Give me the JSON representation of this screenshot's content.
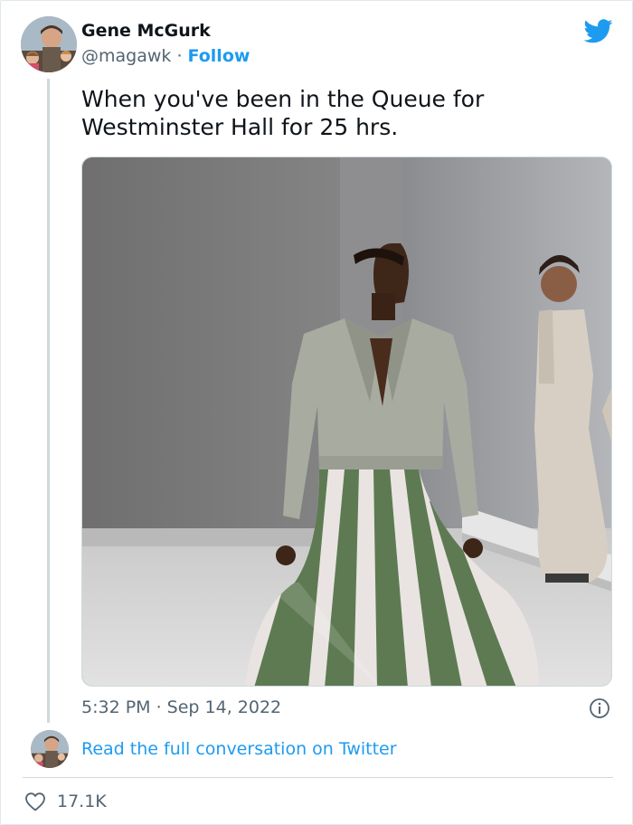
{
  "author": {
    "name": "Gene McGurk",
    "handle": "@magawk",
    "separator": " · ",
    "follow_label": "Follow"
  },
  "tweet": {
    "text": "When you've been in the Queue for\nWestminster Hall for 25 hrs.",
    "timestamp": "5:32 PM · Sep 14, 2022"
  },
  "footer": {
    "read_more_label": "Read the full conversation on Twitter",
    "like_count": "17.1K"
  },
  "icons": {
    "brand": "twitter-bird-icon",
    "info": "info-icon",
    "like": "heart-icon"
  },
  "colors": {
    "accent": "#1d9bf0",
    "secondary_text": "#536471",
    "primary_text": "#0f1419"
  }
}
